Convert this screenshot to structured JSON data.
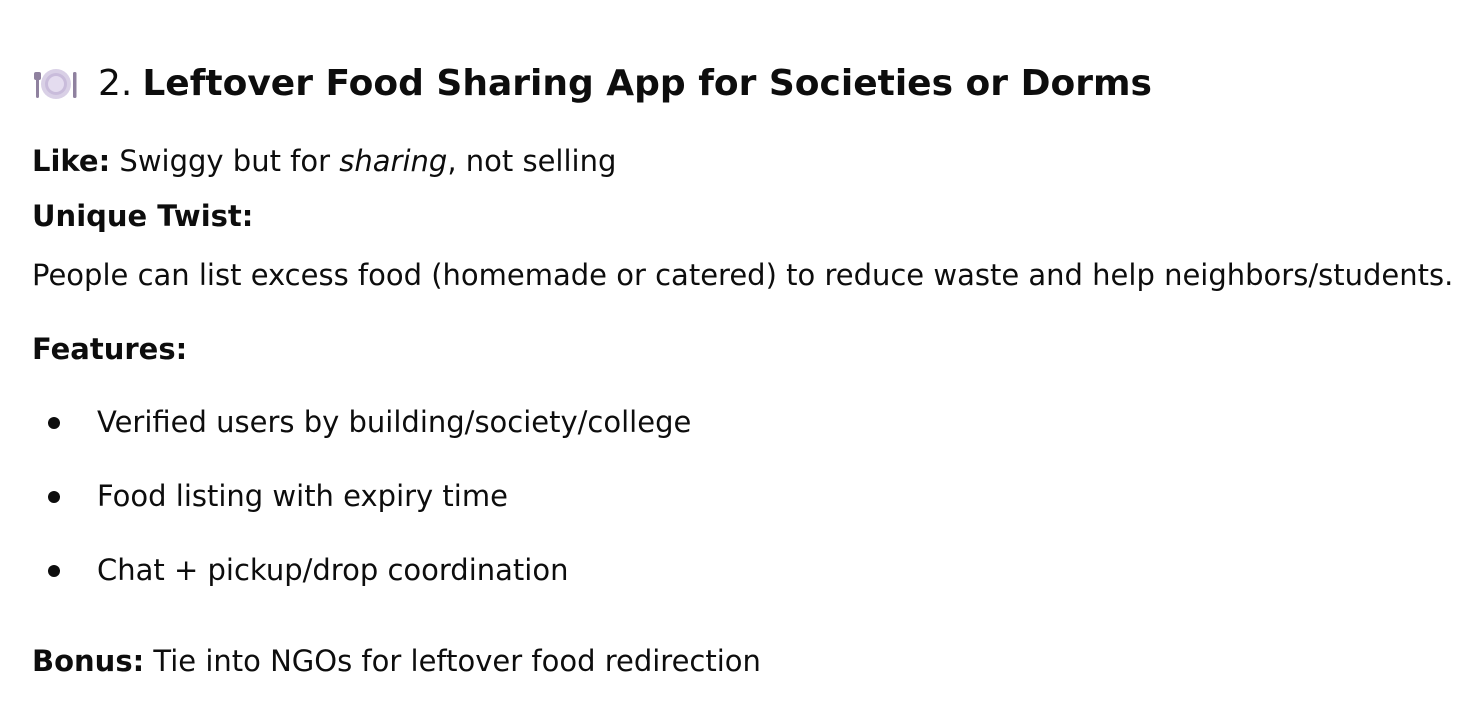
{
  "heading": {
    "icon": "plate-with-cutlery-icon",
    "number": "2.",
    "title": "Leftover Food Sharing App for Societies or Dorms"
  },
  "like": {
    "label": "Like:",
    "text_before": " Swiggy but for ",
    "emphasis": "sharing",
    "text_after": ", not selling"
  },
  "twist": {
    "label": "Unique Twist:",
    "text": "People can list excess food (homemade or catered) to reduce waste and help neighbors/students."
  },
  "features": {
    "label": "Features:",
    "items": [
      "Verified users by building/society/college",
      "Food listing with expiry time",
      "Chat + pickup/drop coordination"
    ]
  },
  "bonus": {
    "label": "Bonus:",
    "text": " Tie into NGOs for leftover food redirection"
  }
}
